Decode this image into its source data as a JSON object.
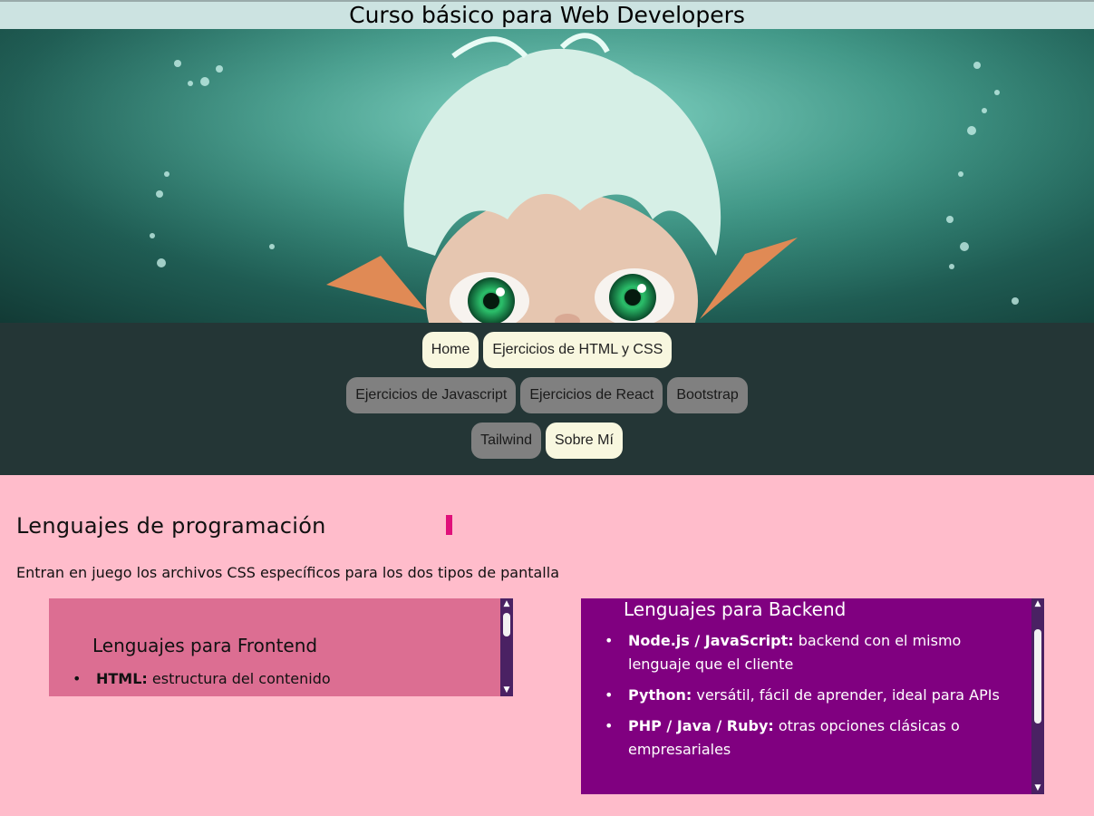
{
  "header": {
    "title": "Curso básico para Web Developers"
  },
  "nav": {
    "rows": [
      [
        {
          "label": "Home",
          "style": "light"
        },
        {
          "label": "Ejercicios de HTML y CSS",
          "style": "light"
        }
      ],
      [
        {
          "label": "Ejercicios de Javascript",
          "style": "grey"
        },
        {
          "label": "Ejercicios de React",
          "style": "grey"
        },
        {
          "label": "Bootstrap",
          "style": "grey"
        }
      ],
      [
        {
          "label": "Tailwind",
          "style": "grey"
        },
        {
          "label": "Sobre Mí",
          "style": "light"
        }
      ]
    ]
  },
  "main": {
    "heading": "Lenguajes de programación",
    "intro": "Entran en juego los archivos CSS específicos para los dos tipos de pantalla",
    "frontend": {
      "title": "Lenguajes para Frontend",
      "items": [
        {
          "term": "HTML:",
          "desc": " estructura del contenido"
        }
      ]
    },
    "backend": {
      "title": "Lenguajes para Backend",
      "items": [
        {
          "term": "Node.js / JavaScript:",
          "desc": " backend con el mismo lenguaje que el cliente"
        },
        {
          "term": "Python:",
          "desc": " versátil, fácil de aprender, ideal para APIs"
        },
        {
          "term": "PHP / Java / Ruby:",
          "desc": " otras opciones clásicas o empresariales"
        }
      ]
    }
  },
  "colors": {
    "page_bg": "#ffbccb",
    "nav_bg": "#243636",
    "frontend_bg": "#dc6e92",
    "backend_bg": "#800080",
    "accent": "#e0107a"
  }
}
